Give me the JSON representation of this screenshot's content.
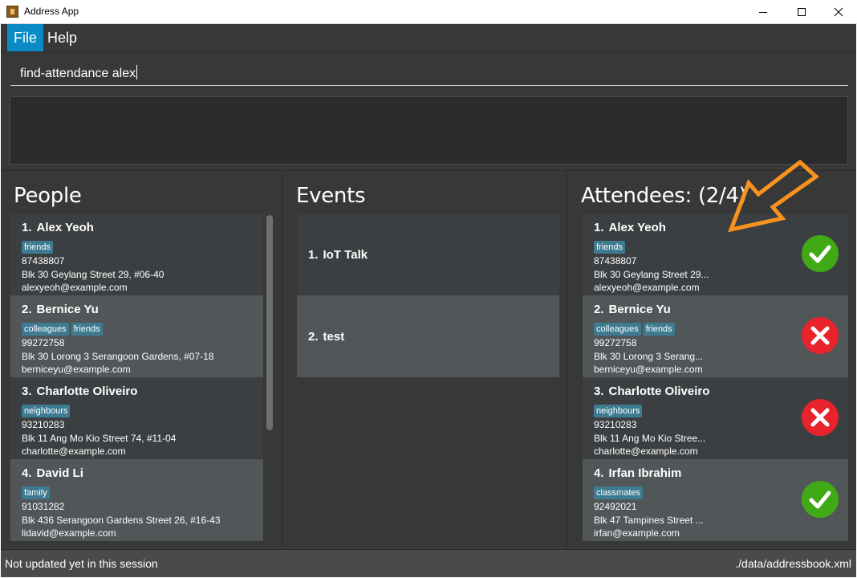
{
  "window": {
    "title": "Address App",
    "icon": "address-book-icon"
  },
  "menu": {
    "file": "File",
    "help": "Help"
  },
  "command": {
    "value": "find-attendance alex"
  },
  "result": {
    "text": ""
  },
  "people": {
    "title": "People",
    "items": [
      {
        "index": "1.",
        "name": "Alex Yeoh",
        "tags": [
          "friends"
        ],
        "phone": "87438807",
        "address": "Blk 30 Geylang Street 29, #06-40",
        "email": "alexyeoh@example.com"
      },
      {
        "index": "2.",
        "name": "Bernice Yu",
        "tags": [
          "colleagues",
          "friends"
        ],
        "phone": "99272758",
        "address": "Blk 30 Lorong 3 Serangoon Gardens, #07-18",
        "email": "berniceyu@example.com"
      },
      {
        "index": "3.",
        "name": "Charlotte Oliveiro",
        "tags": [
          "neighbours"
        ],
        "phone": "93210283",
        "address": "Blk 11 Ang Mo Kio Street 74, #11-04",
        "email": "charlotte@example.com"
      },
      {
        "index": "4.",
        "name": "David Li",
        "tags": [
          "family"
        ],
        "phone": "91031282",
        "address": "Blk 436 Serangoon Gardens Street 26, #16-43",
        "email": "lidavid@example.com"
      }
    ]
  },
  "events": {
    "title": "Events",
    "items": [
      {
        "index": "1.",
        "name": "IoT Talk"
      },
      {
        "index": "2.",
        "name": "test"
      }
    ]
  },
  "attendees": {
    "title": "Attendees: (2/4)",
    "items": [
      {
        "index": "1.",
        "name": "Alex Yeoh",
        "tags": [
          "friends"
        ],
        "phone": "87438807",
        "address": "Blk 30 Geylang Street 29...",
        "email": "alexyeoh@example.com",
        "attended": true
      },
      {
        "index": "2.",
        "name": "Bernice Yu",
        "tags": [
          "colleagues",
          "friends"
        ],
        "phone": "99272758",
        "address": "Blk 30 Lorong 3 Serang...",
        "email": "berniceyu@example.com",
        "attended": false
      },
      {
        "index": "3.",
        "name": "Charlotte Oliveiro",
        "tags": [
          "neighbours"
        ],
        "phone": "93210283",
        "address": "Blk 11 Ang Mo Kio Stree...",
        "email": "charlotte@example.com",
        "attended": false
      },
      {
        "index": "4.",
        "name": "Irfan Ibrahim",
        "tags": [
          "classmates"
        ],
        "phone": "92492021",
        "address": "Blk 47 Tampines Street ...",
        "email": "irfan@example.com",
        "attended": true
      }
    ]
  },
  "statusbar": {
    "left": "Not updated yet in this session",
    "right": "./data/addressbook.xml"
  },
  "colors": {
    "accent": "#0a8bc6",
    "tag": "#3e7b91",
    "present": "#41a915",
    "absent": "#e8232c",
    "annotation_arrow": "#f7931e"
  },
  "icons": {
    "present": "checkmark-icon",
    "absent": "cross-icon",
    "annotation": "arrow-annotation-icon"
  }
}
